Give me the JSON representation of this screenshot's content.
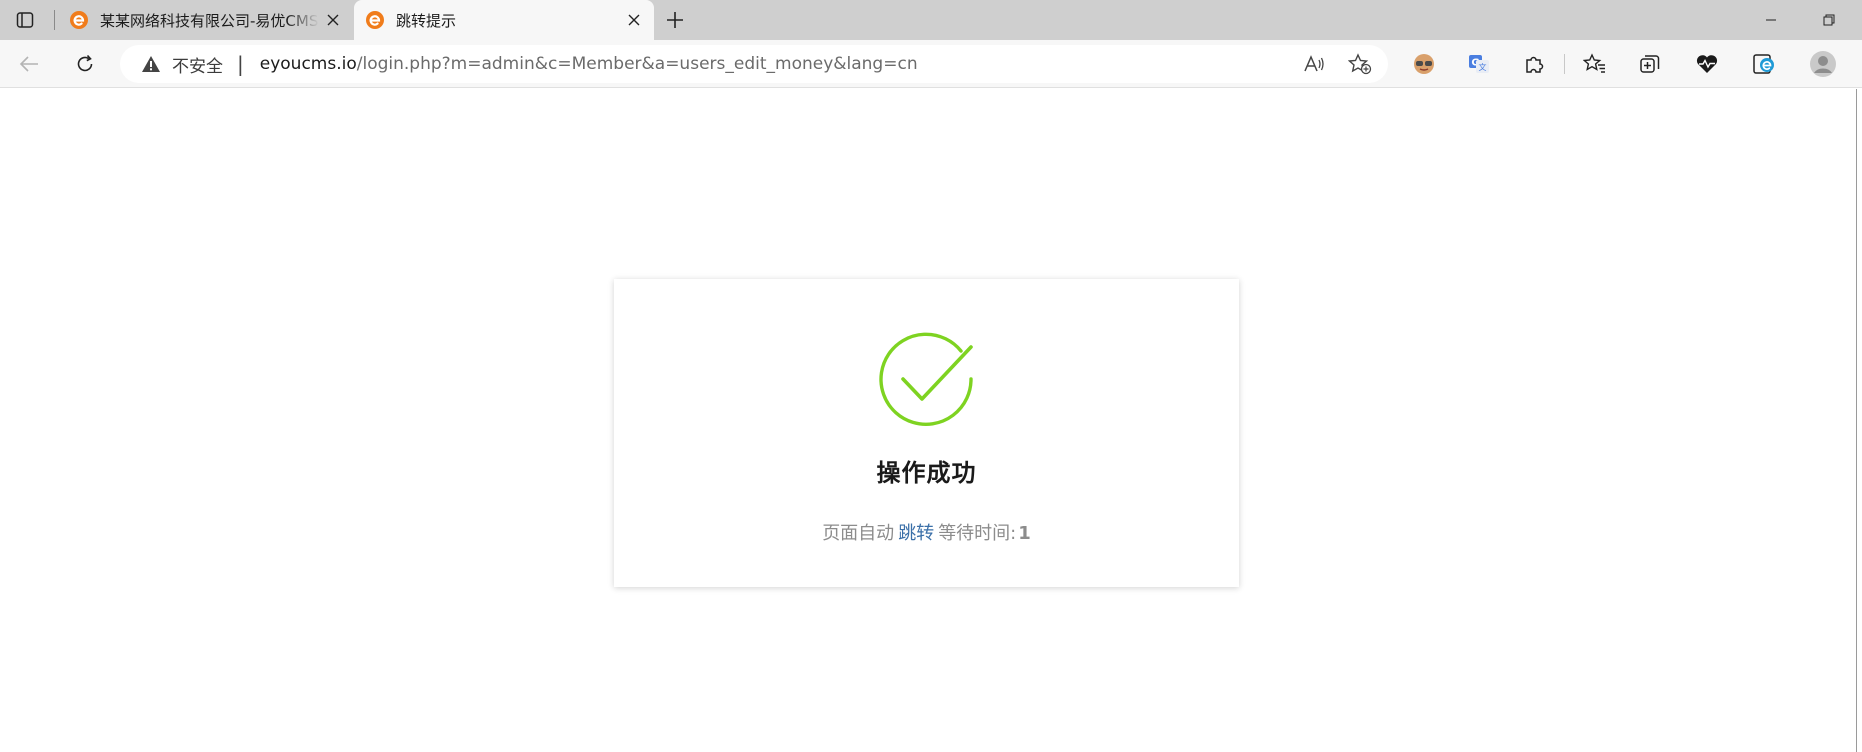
{
  "tabs": [
    {
      "title": "某某网络科技有限公司-易优CMS",
      "active": false,
      "favicon": "eyoucms-logo-icon"
    },
    {
      "title": "跳转提示",
      "active": true,
      "favicon": "eyoucms-logo-icon"
    }
  ],
  "toolbar": {
    "security_label": "不安全",
    "url_domain": "eyoucms.io",
    "url_path": "/login.php?m=admin&c=Member&a=users_edit_money&lang=cn"
  },
  "page": {
    "title": "操作成功",
    "message_prefix": "页面自动",
    "jump_link": "跳转",
    "wait_label": "等待时间:",
    "wait_seconds": "1"
  },
  "colors": {
    "success_green": "#7ed321",
    "link_blue": "#3a6fa8",
    "favicon_orange": "#f07c1b",
    "tab_strip": "#cfcfcf",
    "toolbar": "#f7f7f7"
  }
}
